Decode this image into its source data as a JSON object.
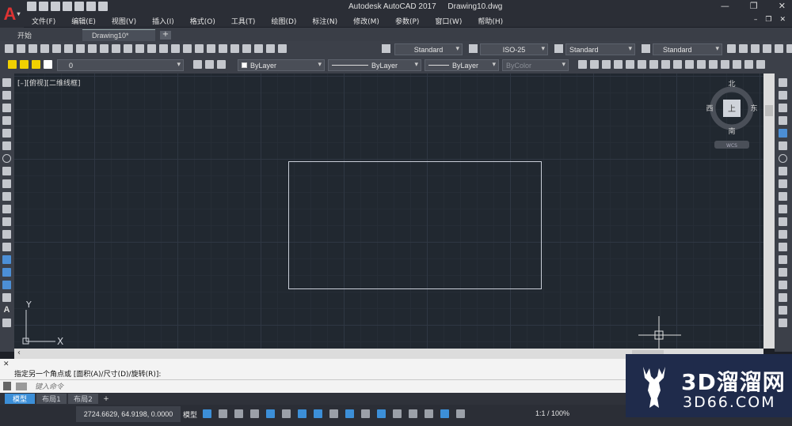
{
  "app": {
    "logo_letter": "A",
    "window_title": "Autodesk AutoCAD 2017",
    "file_name": "Drawing10.dwg"
  },
  "window_controls": {
    "minimize": "—",
    "restore": "❐",
    "close": "✕"
  },
  "menu": {
    "items": [
      "文件(F)",
      "编辑(E)",
      "视图(V)",
      "插入(I)",
      "格式(O)",
      "工具(T)",
      "绘图(D)",
      "标注(N)",
      "修改(M)",
      "参数(P)",
      "窗口(W)",
      "帮助(H)"
    ],
    "doc_controls": {
      "minimize": "–",
      "restore": "❐",
      "close": "✕"
    }
  },
  "tabs": {
    "start": "开始",
    "drawing": "Drawing10*",
    "add": "+"
  },
  "styles_toolbar": {
    "text_style": "Standard",
    "dim_style": "ISO-25",
    "table_style": "Standard",
    "mleader_style": "Standard"
  },
  "layers_toolbar": {
    "layer": "0",
    "color": "ByLayer",
    "linetype": "ByLayer",
    "lineweight": "ByLayer",
    "plot_style": "ByColor"
  },
  "viewport": {
    "label": "[–][俯视][二维线框]",
    "ucs": {
      "x": "X",
      "y": "Y"
    }
  },
  "viewcube": {
    "north": "北",
    "south": "南",
    "east": "东",
    "west": "西",
    "face": "上",
    "wcs": "WCS"
  },
  "command_line": {
    "history": "指定另一个角点或  [面积(A)/尺寸(D)/旋转(R)]:",
    "placeholder": "键入命令"
  },
  "layout_tabs": {
    "model": "模型",
    "layout1": "布局1",
    "layout2": "布局2",
    "add": "+"
  },
  "status_bar": {
    "coordinates": "2724.6629, 64.9198, 0.0000",
    "model": "模型",
    "zoom": "1:1 / 100%"
  },
  "watermark": {
    "title": "3D溜溜网",
    "url": "3D66.COM"
  }
}
